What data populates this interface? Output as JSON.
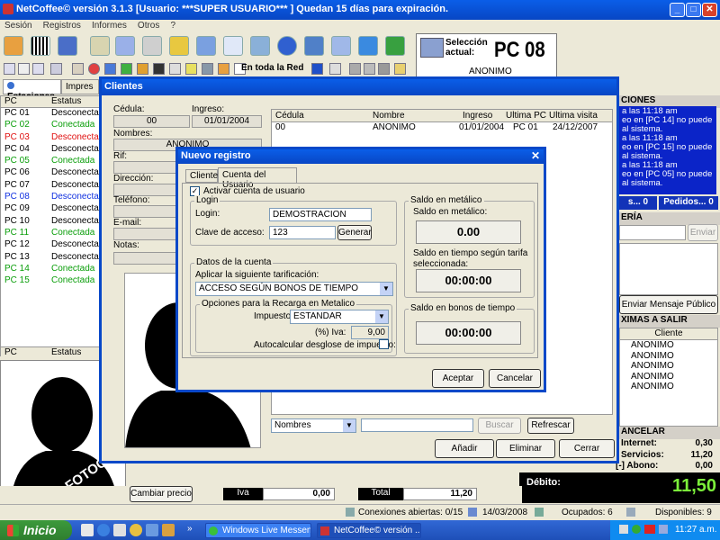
{
  "app": {
    "title": "NetCoffee© versión  3.1.3   [Usuario: ***SUPER USUARIO*** ]   Quedan 15 días para expiración.",
    "menu": [
      "Sesión",
      "Registros",
      "Informes",
      "Otros",
      "?"
    ],
    "toolbar_network_label": "En toda la Red"
  },
  "selection": {
    "label": "Selección actual:",
    "pc": "PC 08",
    "user": "ANONIMO"
  },
  "left_panel": {
    "tabs": [
      "Estaciones",
      "Impres"
    ],
    "columns": [
      "PC",
      "Estatus"
    ],
    "rows": [
      {
        "pc": "PC 01",
        "status": "Desconectada",
        "color": "#000000"
      },
      {
        "pc": "PC 02",
        "status": "Conectada",
        "color": "#0a9e0a"
      },
      {
        "pc": "PC 03",
        "status": "Desconectada",
        "color": "#e01010"
      },
      {
        "pc": "PC 04",
        "status": "Desconectada",
        "color": "#000000"
      },
      {
        "pc": "PC 05",
        "status": "Conectada",
        "color": "#0a9e0a"
      },
      {
        "pc": "PC 06",
        "status": "Desconectada",
        "color": "#000000"
      },
      {
        "pc": "PC 07",
        "status": "Desconectada",
        "color": "#000000"
      },
      {
        "pc": "PC 08",
        "status": "Desconectada",
        "color": "#1030e0"
      },
      {
        "pc": "PC 09",
        "status": "Desconectada",
        "color": "#000000"
      },
      {
        "pc": "PC 10",
        "status": "Desconectada",
        "color": "#000000"
      },
      {
        "pc": "PC 11",
        "status": "Conectada",
        "color": "#0a9e0a"
      },
      {
        "pc": "PC 12",
        "status": "Desconectada",
        "color": "#000000"
      },
      {
        "pc": "PC 13",
        "status": "Desconectada",
        "color": "#000000"
      },
      {
        "pc": "PC 14",
        "status": "Conectada",
        "color": "#0a9e0a"
      },
      {
        "pc": "PC 15",
        "status": "Conectada",
        "color": "#0a9e0a"
      }
    ],
    "footer_columns": [
      "PC",
      "Estatus"
    ],
    "photo_watermark": "SIN FOTOGRAFIA",
    "change_price_button": "Cambiar precio",
    "iva_label": "Iva",
    "iva_value": "0,00",
    "total_label": "Total",
    "total_value": "11,20"
  },
  "right_panel": {
    "notifications_header": "CIONES",
    "messages": [
      "a las 11:18 am",
      "eo en [PC 14] no puede",
      "al sistema.",
      "a las 11:18 am",
      "eo en [PC 15] no puede",
      "al sistema.",
      "a las 11:18 am",
      "eo en [PC 05] no puede",
      "al sistema."
    ],
    "btn_left": "s... 0",
    "btn_pedidos": "Pedidos... 0",
    "messaging_header": "ERÍA",
    "send_button": "Enviar",
    "public_message_button": "Enviar Mensaje Público",
    "next_out_header": "XIMAS A SALIR",
    "next_out_column": "Cliente",
    "next_out_rows": [
      "ANONIMO",
      "ANONIMO",
      "ANONIMO",
      "ANONIMO",
      "ANONIMO"
    ],
    "cancel_header": "ANCELAR",
    "internet_label": "Internet:",
    "internet_value": "0,30",
    "services_label": "Servicios:",
    "services_value": "11,20",
    "credit_label": "[-] Abono:",
    "credit_value": "0,00",
    "debit_label": "Débito:",
    "debit_value": "11,50"
  },
  "clientes": {
    "title": "Clientes",
    "cedula_label": "Cédula:",
    "cedula_value": "00",
    "ingreso_label": "Ingreso:",
    "ingreso_value": "01/01/2004",
    "nombres_label": "Nombres:",
    "nombres_value": "ANONIMO",
    "rif_label": "Rif:",
    "direccion_label": "Dirección:",
    "telefono_label": "Teléfono:",
    "email_label": "E-mail:",
    "notas_label": "Notas:",
    "grid_columns": [
      "Cédula",
      "Nombre",
      "Ingreso",
      "Ultima PC",
      "Ultima visita"
    ],
    "grid_rows": [
      {
        "cedula": "00",
        "nombre": "ANONIMO",
        "ingreso": "01/01/2004",
        "ultima_pc": "PC 01",
        "ultima_visita": "24/12/2007"
      }
    ],
    "search_field": "Nombres",
    "search_button": "Buscar",
    "refresh_button": "Refrescar",
    "add_button": "Añadir",
    "delete_button": "Eliminar",
    "close_button": "Cerrar"
  },
  "nuevo_registro": {
    "title": "Nuevo registro",
    "tabs": [
      "Cliente",
      "Cuenta del Usuario"
    ],
    "activate_label": "Activar cuenta de usuario",
    "activate_checked": true,
    "login_group": "Login",
    "login_label": "Login:",
    "login_value": "DEMOSTRACION",
    "password_label": "Clave de acceso:",
    "password_value": "123",
    "generate_button": "Generar",
    "account_group": "Datos de la cuenta",
    "rate_label": "Aplicar la siguiente tarificación:",
    "rate_value": "ACCESO SEGÚN BONOS DE TIEMPO",
    "recharge_group": "Opciones para la Recarga en Metalico",
    "tax_label": "Impuesto:",
    "tax_value": "ESTANDAR",
    "iva_pct_label": "(%) Iva:",
    "iva_pct_value": "9,00",
    "autocalc_label": "Autocalcular desglose de impuesto:",
    "cash_group": "Saldo en metálico",
    "cash_label": "Saldo en metálico:",
    "cash_value": "0.00",
    "time_by_rate_label": "Saldo en tiempo según tarifa seleccionada:",
    "time_by_rate_value": "00:00:00",
    "bonus_group": "Saldo en bonos de tiempo",
    "bonus_value": "00:00:00",
    "accept_button": "Aceptar",
    "cancel_button": "Cancelar"
  },
  "status": {
    "connections": "Conexiones abiertas: 0/15",
    "date": "14/03/2008",
    "occupied": "Ocupados: 6",
    "available": "Disponibles: 9"
  },
  "taskbar": {
    "start": "Inicio",
    "tasks": [
      "Windows Live Messen...",
      "NetCoffee© versión ..."
    ],
    "clock": "11:27 a.m."
  }
}
